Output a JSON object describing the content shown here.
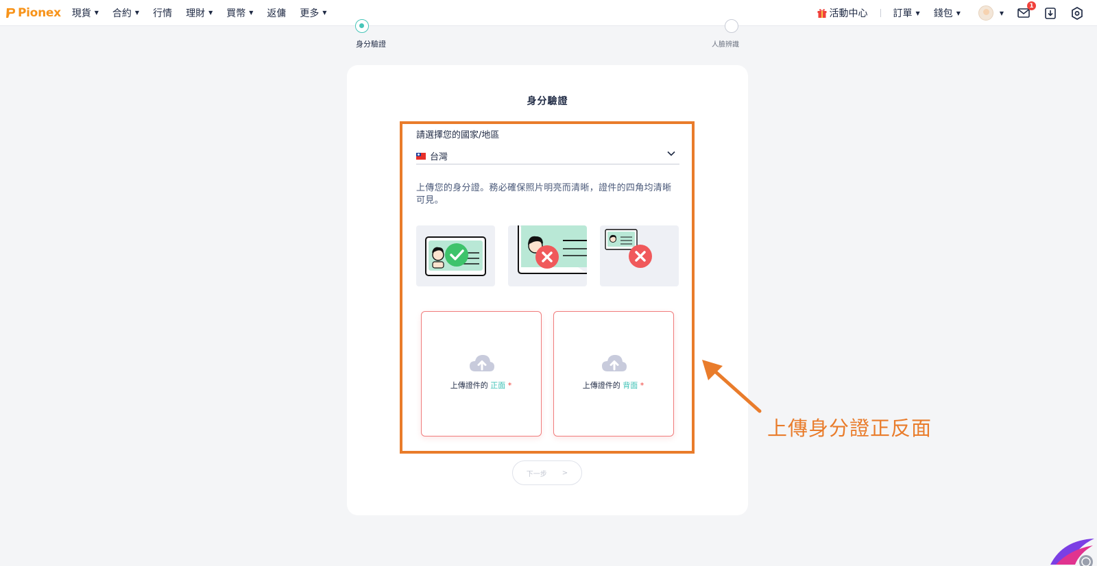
{
  "brand": {
    "name": "Pionex",
    "color": "#f7931a"
  },
  "nav": {
    "items": [
      {
        "label": "現貨",
        "has_caret": true
      },
      {
        "label": "合約",
        "has_caret": true
      },
      {
        "label": "行情",
        "has_caret": false
      },
      {
        "label": "理財",
        "has_caret": true
      },
      {
        "label": "買幣",
        "has_caret": true
      },
      {
        "label": "返傭",
        "has_caret": false
      },
      {
        "label": "更多",
        "has_caret": true
      }
    ],
    "caret": "▼"
  },
  "nav_right": {
    "activity_center": "活動中心",
    "orders": "訂單",
    "wallet": "錢包",
    "mail_badge": "1",
    "caret": "▼"
  },
  "steps": [
    {
      "label": "身分驗證",
      "active": true
    },
    {
      "label": "人臉辨識",
      "active": false
    }
  ],
  "card": {
    "title": "身分驗證",
    "country_label": "請選擇您的國家/地區",
    "country_value": "台灣",
    "description": "上傳您的身分證。務必確保照片明亮而清晰，證件的四角均清晰可見。",
    "upload_front": {
      "prefix": "上傳證件的",
      "accent": "正面",
      "required": "*"
    },
    "upload_back": {
      "prefix": "上傳證件的",
      "accent": "背面",
      "required": "*"
    },
    "next": {
      "label": "下一步",
      "arrow": ">"
    }
  },
  "annotation": {
    "text": "上傳身分證正反面",
    "color": "#e97c2b"
  },
  "colors": {
    "accent_teal": "#3cc1b5",
    "error_red": "#f0413b",
    "highlight_orange": "#e97c2b",
    "id_card_green": "#b9e8d6",
    "check_green": "#3ec36b",
    "cross_red": "#f0595b"
  },
  "icons": [
    "gift-icon",
    "mail-icon",
    "download-icon",
    "settings-icon",
    "chevron-down-icon",
    "upload-cloud-icon",
    "check-icon",
    "cross-icon"
  ]
}
